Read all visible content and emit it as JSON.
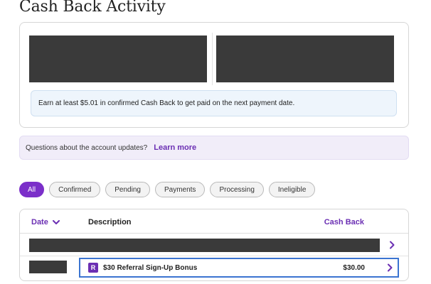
{
  "page": {
    "title": "Cash Back Activity"
  },
  "summary": {
    "notice": "Earn at least $5.01 in confirmed Cash Back to get paid on the next payment date."
  },
  "help": {
    "question": "Questions about the account updates?",
    "link": "Learn more"
  },
  "filters": [
    {
      "label": "All",
      "active": true
    },
    {
      "label": "Confirmed",
      "active": false
    },
    {
      "label": "Pending",
      "active": false
    },
    {
      "label": "Payments",
      "active": false
    },
    {
      "label": "Processing",
      "active": false
    },
    {
      "label": "Ineligible",
      "active": false
    }
  ],
  "table": {
    "headers": {
      "date": "Date",
      "description": "Description",
      "cash_back": "Cash Back"
    },
    "rows": [
      {
        "description": "",
        "amount": "",
        "redacted": true
      },
      {
        "badge": "R",
        "description": "$30 Referral Sign-Up Bonus",
        "amount": "$30.00",
        "highlighted": true
      }
    ]
  },
  "colors": {
    "accent": "#7b2fc9",
    "link": "#6b2fb3",
    "highlight_border": "#3b74d1",
    "notice_bg": "#eef5fc",
    "help_bg": "#f1edf9"
  },
  "icons": {
    "sort": "chevron-down-icon",
    "row": "chevron-right-icon"
  }
}
